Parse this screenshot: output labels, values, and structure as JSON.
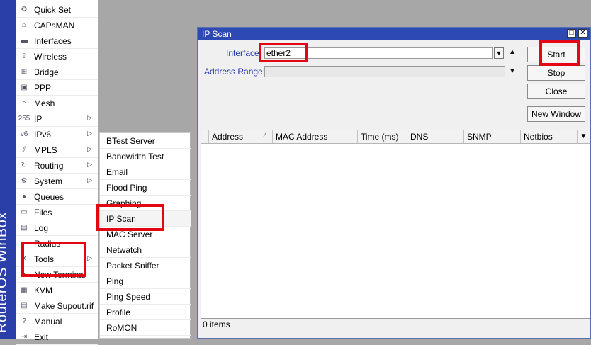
{
  "brand": "RouterOS WinBox",
  "sidebar": {
    "items": [
      {
        "label": "Quick Set",
        "icon": "quick-set-icon",
        "glyph": "⚙",
        "submenu": false
      },
      {
        "label": "CAPsMAN",
        "icon": "capsman-icon",
        "glyph": "⌂",
        "submenu": false
      },
      {
        "label": "Interfaces",
        "icon": "interfaces-icon",
        "glyph": "▬",
        "submenu": false
      },
      {
        "label": "Wireless",
        "icon": "wireless-icon",
        "glyph": "⟟",
        "submenu": false
      },
      {
        "label": "Bridge",
        "icon": "bridge-icon",
        "glyph": "⊞",
        "submenu": false
      },
      {
        "label": "PPP",
        "icon": "ppp-icon",
        "glyph": "▣",
        "submenu": false
      },
      {
        "label": "Mesh",
        "icon": "mesh-icon",
        "glyph": "∘",
        "submenu": false
      },
      {
        "label": "IP",
        "icon": "ip-icon",
        "glyph": "255",
        "submenu": true
      },
      {
        "label": "IPv6",
        "icon": "ipv6-icon",
        "glyph": "v6",
        "submenu": true
      },
      {
        "label": "MPLS",
        "icon": "mpls-icon",
        "glyph": "⫽",
        "submenu": true
      },
      {
        "label": "Routing",
        "icon": "routing-icon",
        "glyph": "↻",
        "submenu": true
      },
      {
        "label": "System",
        "icon": "system-icon",
        "glyph": "⚙",
        "submenu": true
      },
      {
        "label": "Queues",
        "icon": "queues-icon",
        "glyph": "●",
        "submenu": false
      },
      {
        "label": "Files",
        "icon": "files-icon",
        "glyph": "▭",
        "submenu": false
      },
      {
        "label": "Log",
        "icon": "log-icon",
        "glyph": "▤",
        "submenu": false
      },
      {
        "label": "Radius",
        "icon": "radius-icon",
        "glyph": "◐",
        "submenu": false
      },
      {
        "label": "Tools",
        "icon": "tools-icon",
        "glyph": "✕",
        "submenu": true
      },
      {
        "label": "New Terminal",
        "icon": "terminal-icon",
        "glyph": "▪",
        "submenu": false
      },
      {
        "label": "KVM",
        "icon": "kvm-icon",
        "glyph": "▦",
        "submenu": false
      },
      {
        "label": "Make Supout.rif",
        "icon": "supout-icon",
        "glyph": "▤",
        "submenu": false
      },
      {
        "label": "Manual",
        "icon": "manual-icon",
        "glyph": "?",
        "submenu": false
      },
      {
        "label": "Exit",
        "icon": "exit-icon",
        "glyph": "⇥",
        "submenu": false
      }
    ]
  },
  "tools_menu": {
    "items": [
      "BTest Server",
      "Bandwidth Test",
      "Email",
      "Flood Ping",
      "Graphing",
      "IP Scan",
      "MAC Server",
      "Netwatch",
      "Packet Sniffer",
      "Ping",
      "Ping Speed",
      "Profile",
      "RoMON"
    ]
  },
  "window": {
    "title": "IP Scan",
    "interface_label": "Interface:",
    "interface_value": "ether2",
    "address_range_label": "Address Range:",
    "address_range_value": "",
    "buttons": {
      "start": "Start",
      "stop": "Stop",
      "close": "Close",
      "new_window": "New Window"
    },
    "columns": [
      "Address",
      "MAC Address",
      "Time (ms)",
      "DNS",
      "SNMP",
      "Netbios"
    ],
    "status": "0 items"
  },
  "colors": {
    "title_bar": "#2d49b3",
    "brand_bar": "#2b3fa8",
    "highlight": "#e30613",
    "label": "#2433a8"
  }
}
